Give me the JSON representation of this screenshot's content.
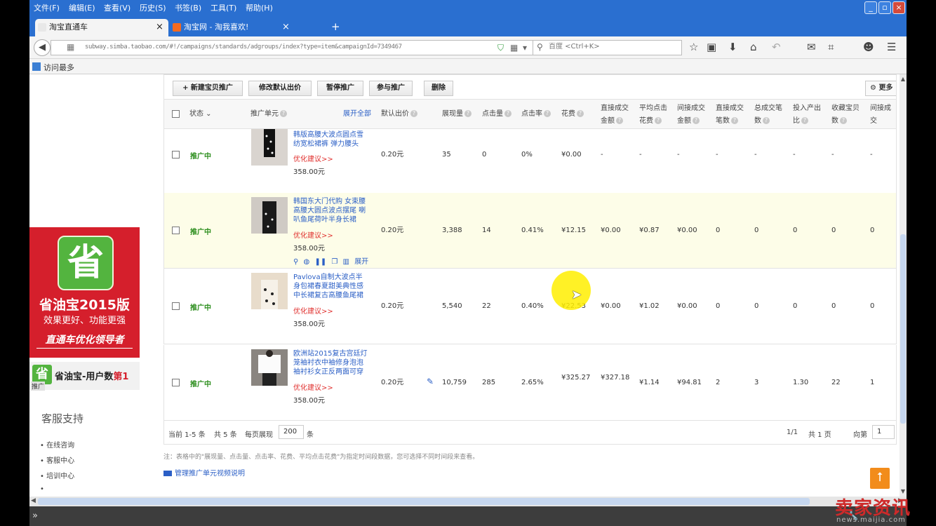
{
  "browser": {
    "menu": [
      "文件(F)",
      "编辑(E)",
      "查看(V)",
      "历史(S)",
      "书签(B)",
      "工具(T)",
      "帮助(H)"
    ],
    "tabs": [
      {
        "label": "淘宝直通车",
        "close": "×"
      },
      {
        "label": "淘宝网 - 淘我喜欢!",
        "close": "×"
      }
    ],
    "new_tab": "+",
    "url": "subway.simba.taobao.com/#!/campaigns/standards/adgroups/index?type=item&campaignId=7349467",
    "search_placeholder": "百度 <Ctrl+K>",
    "bookmark": "访问最多"
  },
  "sidebar": {
    "ad_icon": "省",
    "ad_title": "省油宝2015版",
    "ad_subtitle": "效果更好、功能更强",
    "ad_slogan": "直通车优化领导者",
    "ad_bar_prefix": "省油宝-用户数",
    "ad_bar_highlight": "第1",
    "ad_bar_tag": "推广",
    "service_title": "客服支持",
    "service_items": [
      "在线咨询",
      "客服中心",
      "培训中心",
      ""
    ]
  },
  "toolbar": {
    "new_promo": "+ 新建宝贝推广",
    "modify_bid": "修改默认出价",
    "pause": "暂停推广",
    "join": "参与推广",
    "delete": "删除",
    "more": "更多"
  },
  "table": {
    "headers": {
      "status": "状态",
      "unit": "推广单元",
      "expand_all": "展开全部",
      "default_bid": "默认出价",
      "impressions": "展现量",
      "clicks": "点击量",
      "ctr": "点击率",
      "cost": "花费",
      "direct_amount": [
        "直接成交",
        "金额"
      ],
      "avg_cpc": [
        "平均点击",
        "花费"
      ],
      "indirect_amount": [
        "间接成交",
        "金额"
      ],
      "direct_orders": [
        "直接成交",
        "笔数"
      ],
      "total_orders": [
        "总成交笔",
        "数"
      ],
      "roi": [
        "投入产出",
        "比"
      ],
      "favorites": [
        "收藏宝贝",
        "数"
      ],
      "indirect_orders": [
        "间接成交",
        "笔数"
      ]
    },
    "rows": [
      {
        "status": "推广中",
        "title": "韩版高腰大波点圆点雪纺宽松裙裤 弹力腰头",
        "optimize": "优化建议>>",
        "price": "358.00元",
        "bid": "0.20元",
        "impressions": "35",
        "clicks": "0",
        "ctr": "0%",
        "cost": "¥0.00",
        "direct_amount": "-",
        "avg_cpc": "-",
        "indirect_amount": "-",
        "direct_orders": "-",
        "total_orders": "-",
        "roi": "-",
        "favorites": "-",
        "indirect_orders": "-"
      },
      {
        "status": "推广中",
        "title": "韩国东大门代购 女束腰高腰大圆点波点摆尾 喇叭鱼尾荷叶半身长裙",
        "optimize": "优化建议>>",
        "price": "358.00元",
        "expand": "展开",
        "bid": "0.20元",
        "impressions": "3,388",
        "clicks": "14",
        "ctr": "0.41%",
        "cost": "¥12.15",
        "direct_amount": "¥0.00",
        "avg_cpc": "¥0.87",
        "indirect_amount": "¥0.00",
        "direct_orders": "0",
        "total_orders": "0",
        "roi": "0",
        "favorites": "0",
        "indirect_orders": "0"
      },
      {
        "status": "推广中",
        "title": "Pavlova自制大波点半身包裙春夏甜美典性感中长裙复古高腰鱼尾裙",
        "optimize": "优化建议>>",
        "price": "358.00元",
        "bid": "0.20元",
        "impressions": "5,540",
        "clicks": "22",
        "ctr": "0.40%",
        "cost": "¥22.53",
        "direct_amount": "¥0.00",
        "avg_cpc": "¥1.02",
        "indirect_amount": "¥0.00",
        "direct_orders": "0",
        "total_orders": "0",
        "roi": "0",
        "favorites": "0",
        "indirect_orders": "0"
      },
      {
        "status": "推广中",
        "title": "欧洲站2015复古宫廷灯笼袖衬衣中袖修身泡泡袖衬衫女正反两面可穿",
        "optimize": "优化建议>>",
        "price": "358.00元",
        "bid": "0.20元",
        "impressions": "10,759",
        "clicks": "285",
        "ctr": "2.65%",
        "cost": "¥325.27",
        "direct_amount": "¥327.18",
        "avg_cpc": "¥1.14",
        "indirect_amount": "¥94.81",
        "direct_orders": "2",
        "total_orders": "3",
        "roi": "1.30",
        "favorites": "22",
        "indirect_orders": "1"
      }
    ],
    "footer": {
      "range": "当前 1-5 条",
      "total": "共 5 条",
      "per_page_label": "每页展现",
      "per_page": "200",
      "per_page_unit": "条",
      "page": "1/1",
      "total_pages": "共 1 页",
      "goto_label": "向第",
      "goto_value": "1"
    }
  },
  "note": "注：表格中的\"展现量、点击量、点击率、花费、平均点击花费\"为指定时间段数据，您可选择不同时间段来查看。",
  "video_link": "管理推广单元视频说明",
  "watermark": {
    "title": "卖家资讯",
    "domain": "news.maijia.com"
  },
  "colors": {
    "accent_blue": "#2b5fc6",
    "status_green": "#2d8e1e",
    "ad_red": "#d51f2c",
    "browser_blue": "#2a6fd0",
    "warn_red": "#e0302e"
  }
}
